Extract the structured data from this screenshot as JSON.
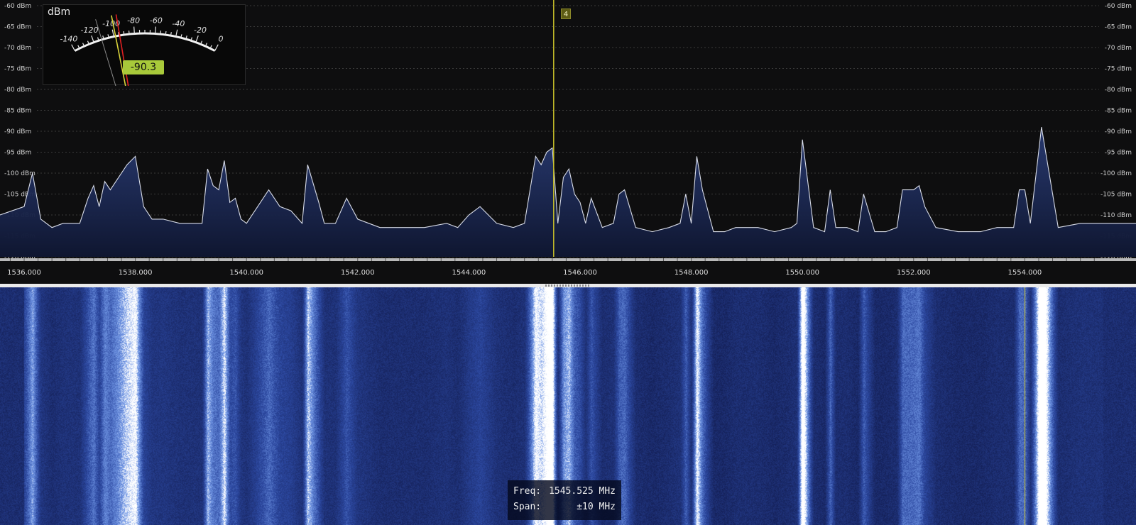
{
  "spectrum": {
    "db_labels": [
      "-60 dBm",
      "-65 dBm",
      "-70 dBm",
      "-75 dBm",
      "-80 dBm",
      "-85 dBm",
      "-90 dBm",
      "-95 dBm",
      "-100 dBm",
      "-105 dBm",
      "-110 dBm",
      "-115 dBm",
      "-120 dBm"
    ],
    "freq_labels": [
      "1536.000",
      "1538.000",
      "1540.000",
      "1542.000",
      "1544.000",
      "1546.000",
      "1548.000",
      "1550.000",
      "1552.000",
      "1554.000"
    ],
    "marker_label": "4",
    "colors": {
      "trace": "#d8dce8",
      "fill_top": "#2a3d78",
      "fill_bottom": "#0f1630",
      "grid": "#3a3a3a",
      "marker": "#c8c02a"
    }
  },
  "smeter": {
    "unit": "dBm",
    "scale_labels": [
      "-140",
      "-120",
      "-100",
      "-80",
      "-60",
      "-40",
      "-20",
      "0"
    ],
    "value": "-90.3",
    "colors": {
      "needle": "#d8d23a",
      "peak": "#e02020",
      "badge": "#a8c93a"
    }
  },
  "info": {
    "freq_label": "Freq:",
    "freq_value": "1545.525 MHz",
    "span_label": "Span:",
    "span_value": "±10 MHz"
  },
  "chart_data": {
    "type": "line",
    "ylim": [
      -122,
      -60
    ],
    "xlim": [
      1535.8,
      1555.5
    ],
    "x": [
      1536.0,
      1536.15,
      1536.3,
      1536.5,
      1536.7,
      1537.0,
      1537.15,
      1537.25,
      1537.35,
      1537.45,
      1537.55,
      1537.7,
      1537.85,
      1538.0,
      1538.15,
      1538.3,
      1538.5,
      1538.8,
      1539.0,
      1539.2,
      1539.3,
      1539.4,
      1539.5,
      1539.6,
      1539.7,
      1539.8,
      1539.9,
      1540.0,
      1540.2,
      1540.4,
      1540.6,
      1540.8,
      1541.0,
      1541.1,
      1541.3,
      1541.4,
      1541.6,
      1541.8,
      1542.0,
      1542.2,
      1542.4,
      1542.8,
      1543.2,
      1543.6,
      1543.8,
      1544.0,
      1544.2,
      1544.5,
      1544.8,
      1545.0,
      1545.2,
      1545.3,
      1545.4,
      1545.5,
      1545.6,
      1545.7,
      1545.8,
      1545.9,
      1546.0,
      1546.1,
      1546.2,
      1546.4,
      1546.6,
      1546.7,
      1546.8,
      1547.0,
      1547.3,
      1547.6,
      1547.8,
      1547.9,
      1548.0,
      1548.1,
      1548.2,
      1548.4,
      1548.6,
      1548.8,
      1549.0,
      1549.2,
      1549.5,
      1549.8,
      1549.9,
      1550.0,
      1550.2,
      1550.4,
      1550.5,
      1550.6,
      1550.8,
      1551.0,
      1551.1,
      1551.3,
      1551.5,
      1551.7,
      1551.8,
      1551.9,
      1552.0,
      1552.1,
      1552.2,
      1552.4,
      1552.8,
      1553.2,
      1553.5,
      1553.8,
      1553.9,
      1554.0,
      1554.1,
      1554.3,
      1554.6,
      1555.0,
      1555.4
    ],
    "y": [
      -108,
      -100,
      -111,
      -113,
      -112,
      -112,
      -106,
      -103,
      -108,
      -102,
      -104,
      -101,
      -98,
      -96,
      -108,
      -111,
      -111,
      -112,
      -112,
      -112,
      -99,
      -103,
      -104,
      -97,
      -107,
      -106,
      -111,
      -112,
      -108,
      -104,
      -108,
      -109,
      -112,
      -98,
      -107,
      -112,
      -112,
      -106,
      -111,
      -112,
      -113,
      -113,
      -113,
      -112,
      -113,
      -110,
      -108,
      -112,
      -113,
      -112,
      -96,
      -98,
      -95,
      -94,
      -112,
      -101,
      -99,
      -105,
      -107,
      -112,
      -106,
      -113,
      -112,
      -105,
      -104,
      -113,
      -114,
      -113,
      -112,
      -105,
      -112,
      -96,
      -104,
      -114,
      -114,
      -113,
      -113,
      -113,
      -114,
      -113,
      -112,
      -92,
      -113,
      -114,
      -104,
      -113,
      -113,
      -114,
      -105,
      -114,
      -114,
      -113,
      -104,
      -104,
      -104,
      -103,
      -108,
      -113,
      -114,
      -114,
      -113,
      -113,
      -104,
      -104,
      -112,
      -89,
      -113,
      -112,
      -112
    ],
    "series": [
      {
        "values": []
      }
    ],
    "marker_freq": 1545.525,
    "grid": true
  }
}
